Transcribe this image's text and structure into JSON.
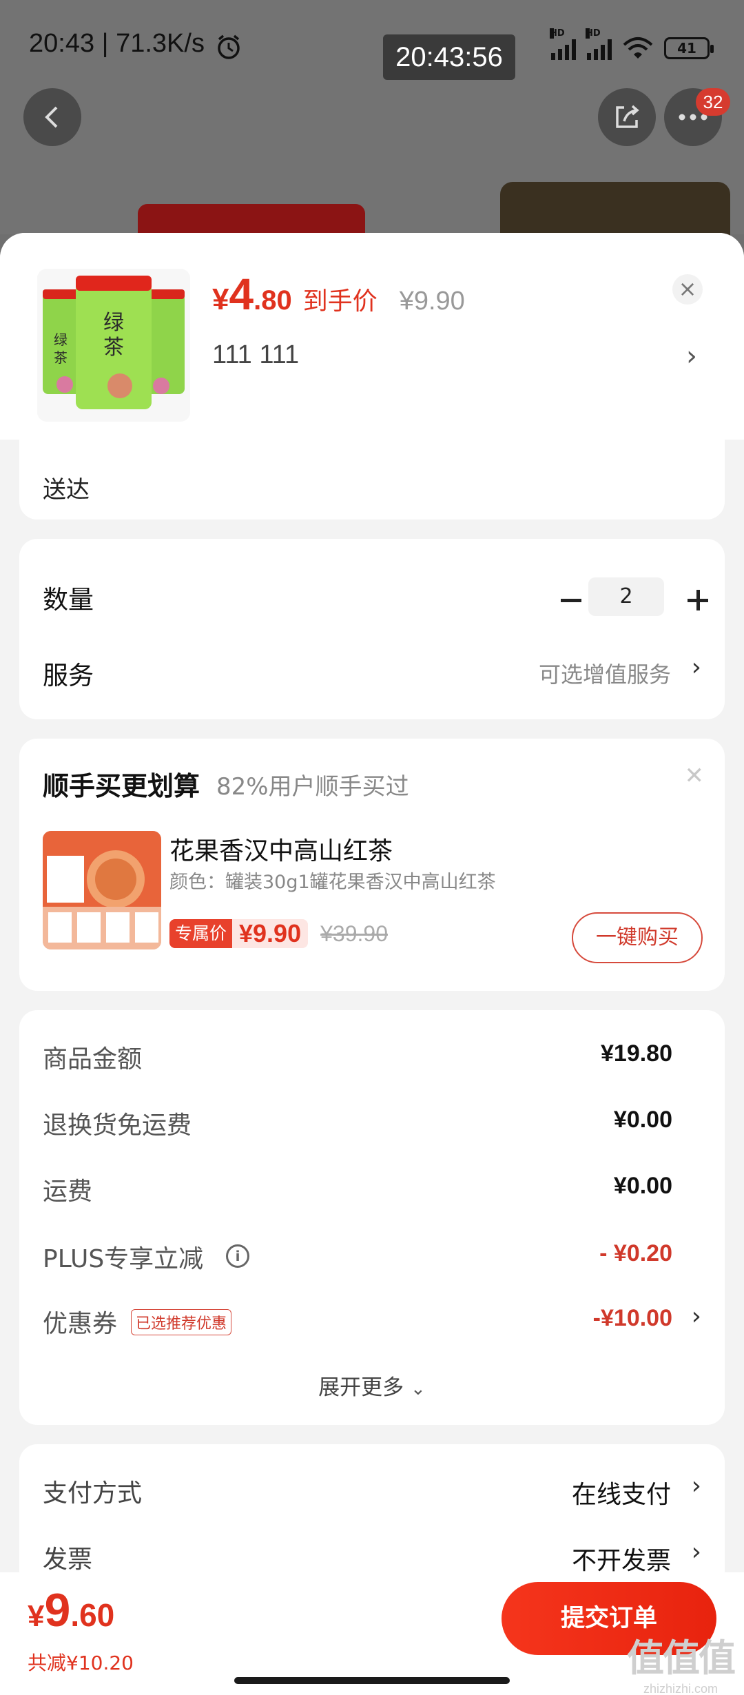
{
  "status_bar": {
    "left_text": "20:43 | 71.3K/s",
    "clock": "20:43:56",
    "battery": "41",
    "hd1": "HD",
    "hd2": "HD"
  },
  "top_nav": {
    "more_badge": "32"
  },
  "product": {
    "price_symbol": "¥",
    "price_int": "4",
    "price_dec": ".80",
    "price_label": "到手价",
    "original_price": "¥9.90",
    "selected_spec": "111  111"
  },
  "delivery": {
    "text": "送达"
  },
  "quantity": {
    "label": "数量",
    "value": "2"
  },
  "service": {
    "label": "服务",
    "value": "可选增值服务"
  },
  "addon": {
    "title": "顺手买更划算",
    "subtitle": "82%用户顺手买过",
    "name": "花果香汉中高山红茶",
    "attr": "颜色：罐装30g1罐花果香汉中高山红茶",
    "exclusive_tag": "专属价",
    "exclusive_price": "¥9.90",
    "original_price": "¥39.90",
    "buy_button": "一键购买"
  },
  "fees": [
    {
      "label": "商品金额",
      "value": "¥19.80"
    },
    {
      "label": "退换货免运费",
      "value": "¥0.00"
    },
    {
      "label": "运费",
      "value": "¥0.00"
    },
    {
      "label": "PLUS专享立减",
      "value": "- ¥0.20"
    },
    {
      "label": "优惠券",
      "value": "-¥10.00",
      "tag": "已选推荐优惠"
    }
  ],
  "expand_more": "展开更多",
  "payment": {
    "label": "支付方式",
    "value": "在线支付"
  },
  "invoice": {
    "label": "发票",
    "value": "不开发票"
  },
  "total": {
    "symbol": "¥",
    "int": "9",
    "dec": ".60",
    "saved": "共减¥10.20",
    "submit": "提交订单"
  },
  "watermark": {
    "logo": "值值值",
    "url": "zhizhizhi.com"
  },
  "colors": {
    "accent": "#e0321e",
    "background": "#f3f3f3"
  }
}
